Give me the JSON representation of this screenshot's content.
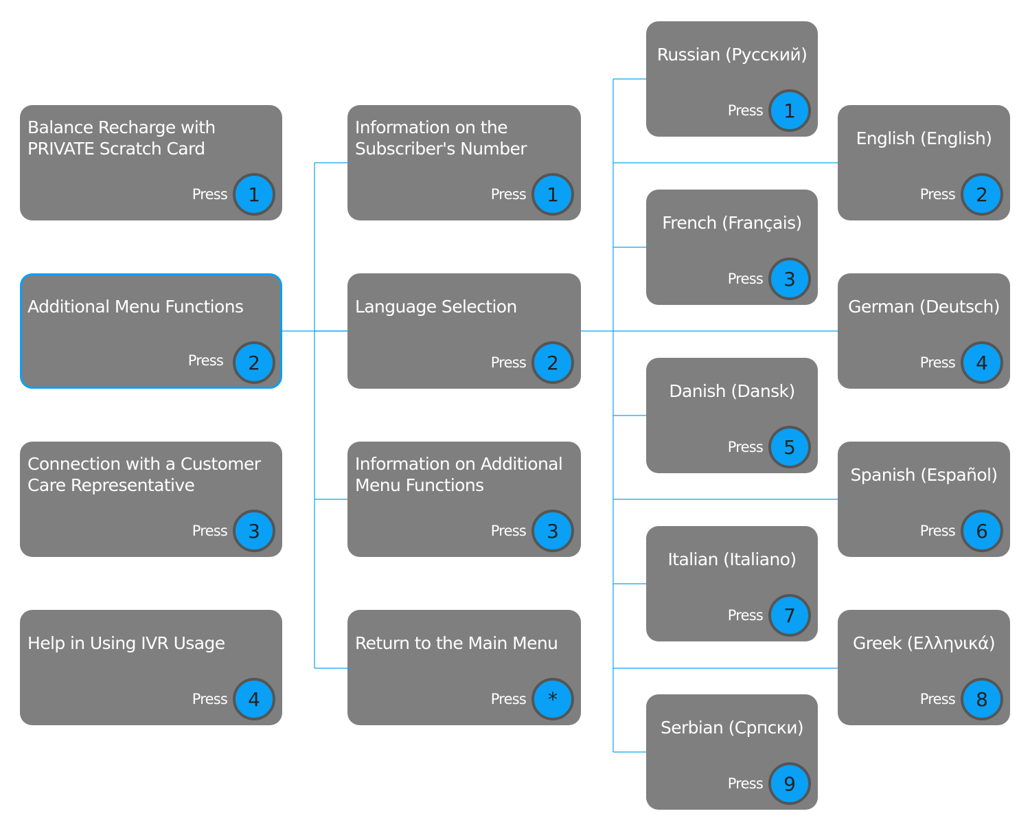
{
  "colors": {
    "node_fill": "#7f7f7f",
    "key_fill": "#0aa0f5",
    "key_border": "#555555",
    "connector": "#0aa0f5",
    "selected_border": "#0aa0f5"
  },
  "press_label": "Press",
  "columns": [
    {
      "align": "left",
      "nodes": [
        {
          "title": "Balance Recharge with PRIVATE Scratch Card",
          "key": "1"
        },
        {
          "title": "Additional Menu Functions",
          "key": "2",
          "selected": true
        },
        {
          "title": "Connection with a Customer Care Representative",
          "key": "3"
        },
        {
          "title": "Help in Using IVR Usage",
          "key": "4"
        }
      ]
    },
    {
      "align": "left",
      "nodes": [
        {
          "title": "Information on the Subscriber's Number",
          "key": "1"
        },
        {
          "title": "Language Selection",
          "key": "2"
        },
        {
          "title": "Information on Additional Menu Functions",
          "key": "3"
        },
        {
          "title": "Return to the Main Menu",
          "key": "*"
        }
      ]
    },
    {
      "align": "center",
      "nodes": [
        {
          "title": "Russian (Русский)",
          "key": "1"
        },
        {
          "title": "French (Français)",
          "key": "3"
        },
        {
          "title": "Danish (Dansk)",
          "key": "5"
        },
        {
          "title": "Italian (Italiano)",
          "key": "7"
        },
        {
          "title": "Serbian (Српски)",
          "key": "9"
        }
      ]
    },
    {
      "align": "center",
      "nodes": [
        {
          "title": "English (English)",
          "key": "2"
        },
        {
          "title": "German (Deutsch)",
          "key": "4"
        },
        {
          "title": "Spanish (Español)",
          "key": "6"
        },
        {
          "title": "Greek (Ελληνικά)",
          "key": "8"
        }
      ]
    }
  ]
}
